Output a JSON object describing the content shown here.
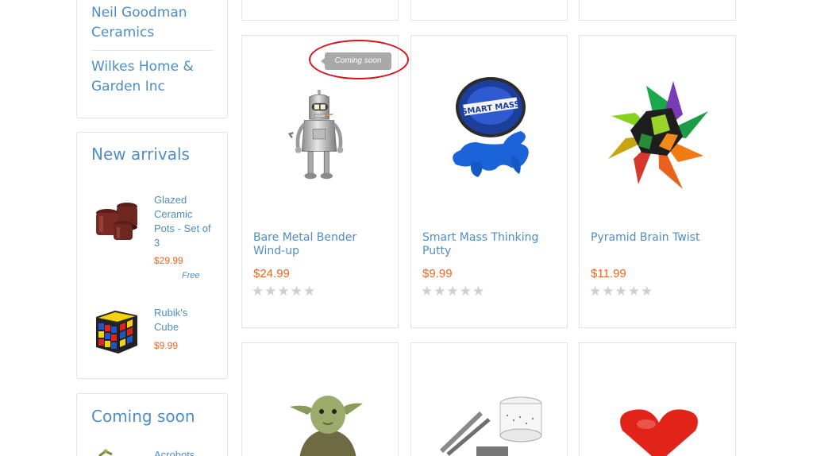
{
  "sidebar": {
    "manufacturers": [
      "Neil Goodman Ceramics",
      "Wilkes Home & Garden Inc"
    ],
    "new_arrivals": {
      "title": "New arrivals",
      "items": [
        {
          "name": "Glazed Ceramic Pots - Set of 3",
          "price": "$29.99",
          "note": "Free"
        },
        {
          "name": "Rubik's Cube",
          "price": "$9.99"
        }
      ]
    },
    "coming_soon": {
      "title": "Coming soon",
      "items": [
        {
          "name": "Acrobots"
        }
      ]
    }
  },
  "products": [
    {
      "name": "Bare Metal Bender Wind-up",
      "price": "$24.99",
      "badge": "Coming soon",
      "rating": 0,
      "image": "bender-robot-image"
    },
    {
      "name": "Smart Mass Thinking Putty",
      "price": "$9.99",
      "rating": 0,
      "image": "putty-tin-image"
    },
    {
      "name": "Pyramid Brain Twist",
      "price": "$11.99",
      "rating": 0,
      "image": "brain-twist-image"
    }
  ],
  "colors": {
    "link": "#4d8ec6",
    "price": "#f26522",
    "highlight": "#d9121b",
    "star_empty": "#cfcfcf"
  }
}
